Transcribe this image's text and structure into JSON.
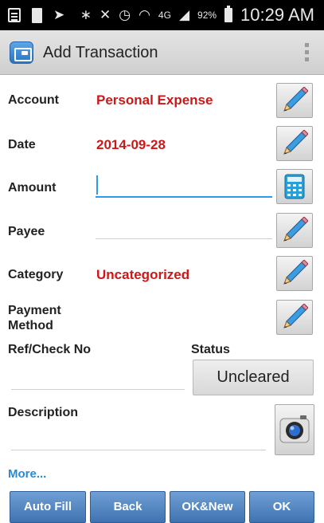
{
  "status_bar": {
    "battery_percent": "92%",
    "time": "10:29 AM",
    "network": "4G",
    "icons": [
      "image-icon",
      "sim-card-icon",
      "location-icon",
      "bluetooth-icon",
      "mute-icon",
      "alarm-icon",
      "wifi-icon",
      "signal-icon",
      "battery-icon"
    ]
  },
  "action_bar": {
    "title": "Add Transaction",
    "icon": "wallet-icon",
    "menu_icon": "overflow-menu-icon"
  },
  "form": {
    "account": {
      "label": "Account",
      "value": "Personal Expense"
    },
    "date": {
      "label": "Date",
      "value": "2014-09-28"
    },
    "amount": {
      "label": "Amount",
      "value": ""
    },
    "payee": {
      "label": "Payee",
      "value": ""
    },
    "category": {
      "label": "Category",
      "value": "Uncategorized"
    },
    "payment_method": {
      "label_line1": "Payment",
      "label_line2": "Method"
    },
    "ref_check_no": {
      "label": "Ref/Check No",
      "value": ""
    },
    "status": {
      "label": "Status",
      "value": "Uncleared"
    },
    "description": {
      "label": "Description",
      "value": ""
    },
    "more_link": "More..."
  },
  "bottom_bar": {
    "auto_fill": "Auto Fill",
    "back": "Back",
    "ok_new": "OK&New",
    "ok": "OK"
  },
  "colors": {
    "value_red": "#cc1818",
    "focus_blue": "#2e9ae8",
    "button_blue": "#4a7fbe",
    "link_blue": "#2a8ad2"
  }
}
